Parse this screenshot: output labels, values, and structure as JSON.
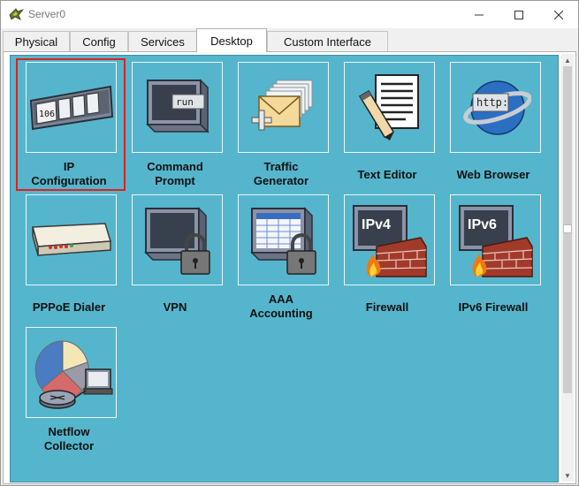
{
  "window": {
    "title": "Server0"
  },
  "tabs": [
    {
      "label": "Physical"
    },
    {
      "label": "Config"
    },
    {
      "label": "Services"
    },
    {
      "label": "Desktop",
      "active": true
    },
    {
      "label": "Custom Interface"
    }
  ],
  "desktop": {
    "background": "#55b5cc",
    "apps": [
      {
        "line1": "IP",
        "line2": "Configuration",
        "icon": "ip-configuration-icon",
        "selected": true
      },
      {
        "line1": "Command",
        "line2": "Prompt",
        "icon": "command-prompt-icon",
        "icon_text": "run"
      },
      {
        "line1": "Traffic",
        "line2": "Generator",
        "icon": "traffic-generator-icon"
      },
      {
        "line1": "Text Editor",
        "icon": "text-editor-icon"
      },
      {
        "line1": "Web Browser",
        "icon": "web-browser-icon",
        "icon_text": "http:"
      },
      {
        "line1": "PPPoE Dialer",
        "icon": "pppoe-dialer-icon"
      },
      {
        "line1": "VPN",
        "icon": "vpn-icon"
      },
      {
        "line1": "AAA",
        "line2": "Accounting",
        "icon": "aaa-accounting-icon"
      },
      {
        "line1": "Firewall",
        "icon": "firewall-icon",
        "icon_text": "IPv4"
      },
      {
        "line1": "IPv6 Firewall",
        "icon": "ipv6-firewall-icon",
        "icon_text": "IPv6"
      },
      {
        "line1": "Netflow",
        "line2": "Collector",
        "icon": "netflow-collector-icon"
      }
    ],
    "ip_config_icon_text": "106",
    "selection_color": "#e0201c"
  }
}
